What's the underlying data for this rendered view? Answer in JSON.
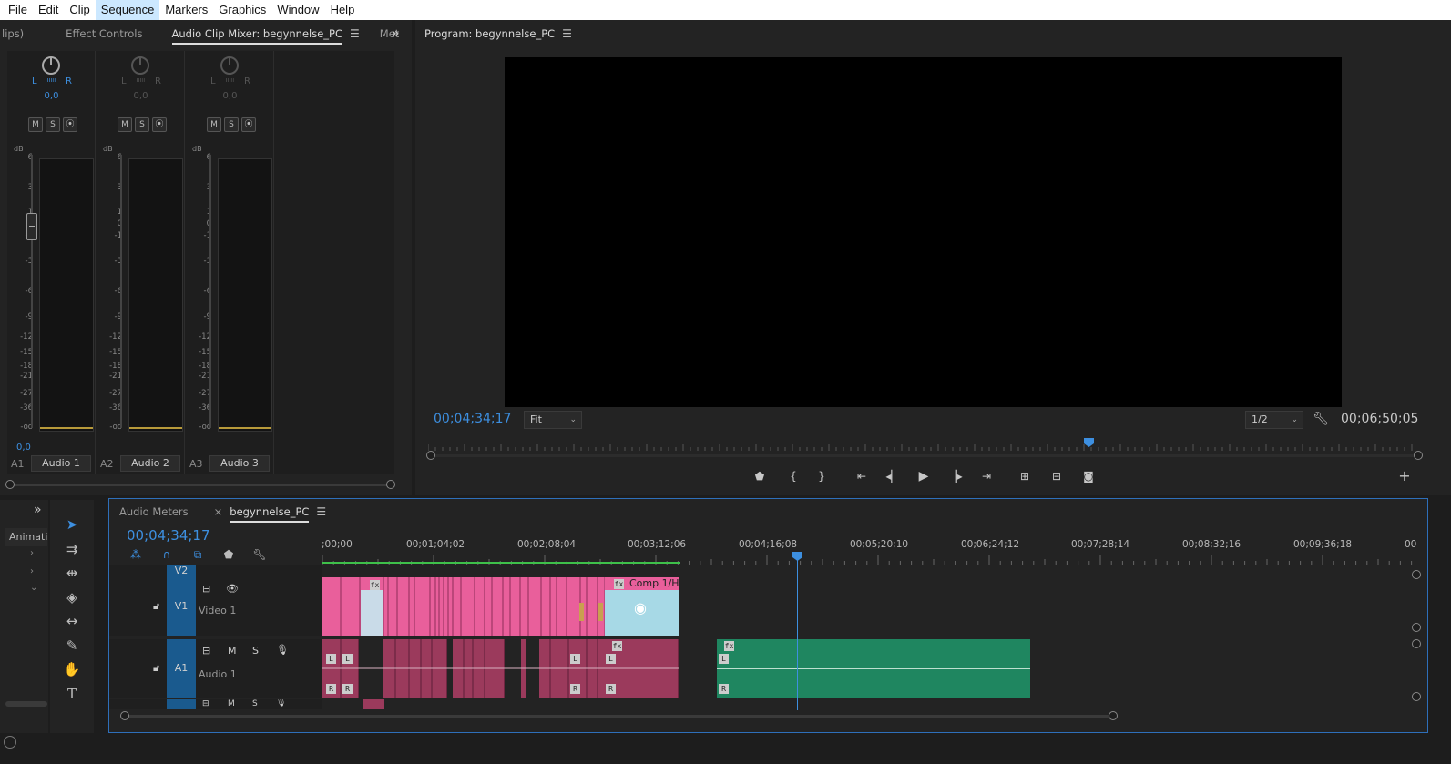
{
  "menu": [
    "File",
    "Edit",
    "Clip",
    "Sequence",
    "Markers",
    "Graphics",
    "Window",
    "Help"
  ],
  "active_menu": "Sequence",
  "source_panel": {
    "tabs": [
      "lips)",
      "Effect Controls",
      "Audio Clip Mixer: begynnelse_PC",
      "Met"
    ],
    "active_tab": "Audio Clip Mixer: begynnelse_PC",
    "overflow_icon": "»"
  },
  "mixer": {
    "channels": [
      {
        "id": "A1",
        "name": "Audio 1",
        "pan_l": "L",
        "pan_r": "R",
        "pan_value": "0,0",
        "volume": "0,0",
        "active": true
      },
      {
        "id": "A2",
        "name": "Audio 2",
        "pan_l": "L",
        "pan_r": "R",
        "pan_value": "0,0",
        "volume": "",
        "active": false
      },
      {
        "id": "A3",
        "name": "Audio 3",
        "pan_l": "L",
        "pan_r": "R",
        "pan_value": "0,0",
        "volume": "",
        "active": false
      }
    ],
    "buttons": [
      "M",
      "S",
      "⦿"
    ],
    "db_label": "dB",
    "db_scale": [
      "6",
      "3",
      "1",
      "0",
      "-1",
      "-3",
      "-6",
      "-9",
      "-12",
      "-15",
      "-18",
      "-21",
      "-27",
      "-36",
      "-oo"
    ]
  },
  "program": {
    "title": "Program: begynnelse_PC",
    "timecode": "00;04;34;17",
    "fit": "Fit",
    "resolution": "1/2",
    "duration": "00;06;50;05"
  },
  "transport": {
    "buttons": [
      "marker-icon",
      "mark-in-icon",
      "mark-out-icon",
      "go-to-in-icon",
      "step-back-icon",
      "play-icon",
      "step-forward-icon",
      "go-to-out-icon",
      "lift-icon",
      "extract-icon",
      "export-frame-icon",
      "add-button-icon"
    ]
  },
  "tools_left": {
    "label": "Animati",
    "overflow": "»"
  },
  "timeline": {
    "tabs": [
      "Audio Meters",
      "begynnelse_PC"
    ],
    "active_tab": "begynnelse_PC",
    "timecode": "00;04;34;17",
    "ruler": [
      ";00;00",
      "00;01;04;02",
      "00;02;08;04",
      "00;03;12;06",
      "00;04;16;08",
      "00;05;20;10",
      "00;06;24;12",
      "00;07;28;14",
      "00;08;32;16",
      "00;09;36;18",
      "00"
    ],
    "tracks": {
      "v2": "V2",
      "v1": "V1",
      "v1_name": "Video 1",
      "a1": "A1",
      "a1_name": "Audio 1"
    },
    "comp_clip": "Comp 1/H",
    "channel_l": "L",
    "channel_r": "R",
    "mute": "M",
    "solo": "S"
  }
}
